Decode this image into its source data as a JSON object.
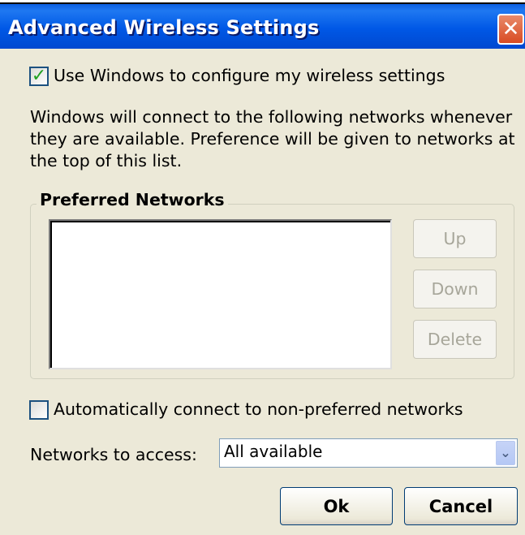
{
  "window": {
    "title": "Advanced Wireless Settings"
  },
  "use_windows": {
    "label": "Use Windows to configure my wireless settings",
    "checked": true
  },
  "description": "Windows will connect to the following networks whenever they are available.  Preference will be given to networks at the top of this list.",
  "preferred": {
    "title": "Preferred Networks",
    "items": [],
    "buttons": {
      "up": "Up",
      "down": "Down",
      "delete": "Delete"
    }
  },
  "auto_connect": {
    "label": "Automatically connect to non-preferred networks",
    "checked": false
  },
  "networks_access": {
    "label": "Networks to access:",
    "value": "All available"
  },
  "footer": {
    "ok": "Ok",
    "cancel": "Cancel"
  },
  "colors": {
    "titlebar": "#0058e6",
    "close": "#d94b22",
    "dialog_bg": "#ece9d8",
    "check": "#21a121"
  }
}
